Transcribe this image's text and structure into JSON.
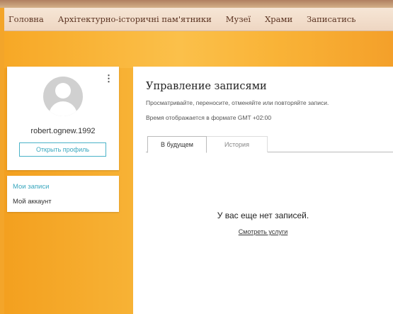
{
  "nav": {
    "items": [
      "Головна",
      "Архітектурно-історичні пам'ятники",
      "Музеї",
      "Храми",
      "Записатись"
    ]
  },
  "profile": {
    "username": "robert.ognew.1992",
    "open_profile_label": "Открыть профиль",
    "menu_icon": "⋮"
  },
  "sidebar": {
    "items": [
      {
        "label": "Мои записи",
        "active": true
      },
      {
        "label": "Мой аккаунт",
        "active": false
      }
    ]
  },
  "main": {
    "title": "Управление записями",
    "description": "Просматривайте, переносите, отменяйте или повторяйте записи.",
    "timezone_note": "Время отображается в формате GMT +02:00",
    "tabs": [
      {
        "label": "В будущем",
        "active": true
      },
      {
        "label": "История",
        "active": false
      }
    ],
    "empty_text": "У вас еще нет записей.",
    "view_services_link": "Смотреть услуги"
  },
  "colors": {
    "accent": "#3aa7be",
    "background": "#f3a52a",
    "navbar": "#f2dfcd"
  }
}
